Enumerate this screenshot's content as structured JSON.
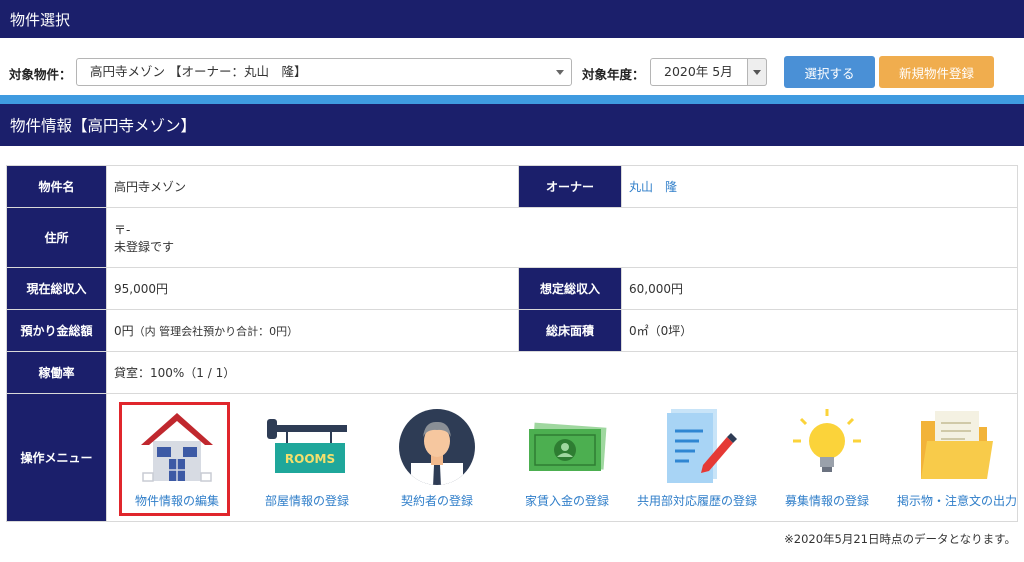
{
  "header": {
    "title": "物件選択"
  },
  "selector": {
    "property_label": "対象物件：",
    "property_value": "高円寺メゾン 【オーナー：丸山　隆】",
    "year_label": "対象年度：",
    "year_value": "2020年 5月",
    "select_button": "選択する",
    "new_button": "新規物件登録"
  },
  "section": {
    "title": "物件情報【高円寺メゾン】"
  },
  "info": {
    "name_label": "物件名",
    "name_value": "高円寺メゾン",
    "owner_label": "オーナー",
    "owner_value": "丸山　隆",
    "address_label": "住所",
    "address_line1": "〒-",
    "address_line2": "未登録です",
    "income_label": "現在総収入",
    "income_value": "95,000円",
    "expected_label": "想定総収入",
    "expected_value": "60,000円",
    "deposit_label": "預かり金総額",
    "deposit_value": "0円",
    "deposit_note": "（内 管理会社預かり合計：0円）",
    "area_label": "総床面積",
    "area_value": "0㎡（0坪）",
    "occupancy_label": "稼働率",
    "occupancy_value": "貸室：100%（1 / 1）",
    "menu_label": "操作メニュー"
  },
  "menu": {
    "items": [
      {
        "label": "物件情報の編集",
        "icon": "house-icon"
      },
      {
        "label": "部屋情報の登録",
        "icon": "rooms-sign-icon"
      },
      {
        "label": "契約者の登録",
        "icon": "person-icon"
      },
      {
        "label": "家賃入金の登録",
        "icon": "banknote-icon"
      },
      {
        "label": "共用部対応履歴の登録",
        "icon": "document-pen-icon"
      },
      {
        "label": "募集情報の登録",
        "icon": "lightbulb-icon"
      },
      {
        "label": "掲示物・注意文の出力",
        "icon": "folder-icon"
      }
    ],
    "rooms_sign_text": "ROOMS"
  },
  "footnote": "※2020年5月21日時点のデータとなります。",
  "colors": {
    "navy": "#1b1f6b",
    "stripe": "#3f9be0",
    "select_button": "#4a90d6",
    "new_button": "#f0ad4e",
    "link": "#2f7ec9",
    "highlight": "#e0262c"
  }
}
